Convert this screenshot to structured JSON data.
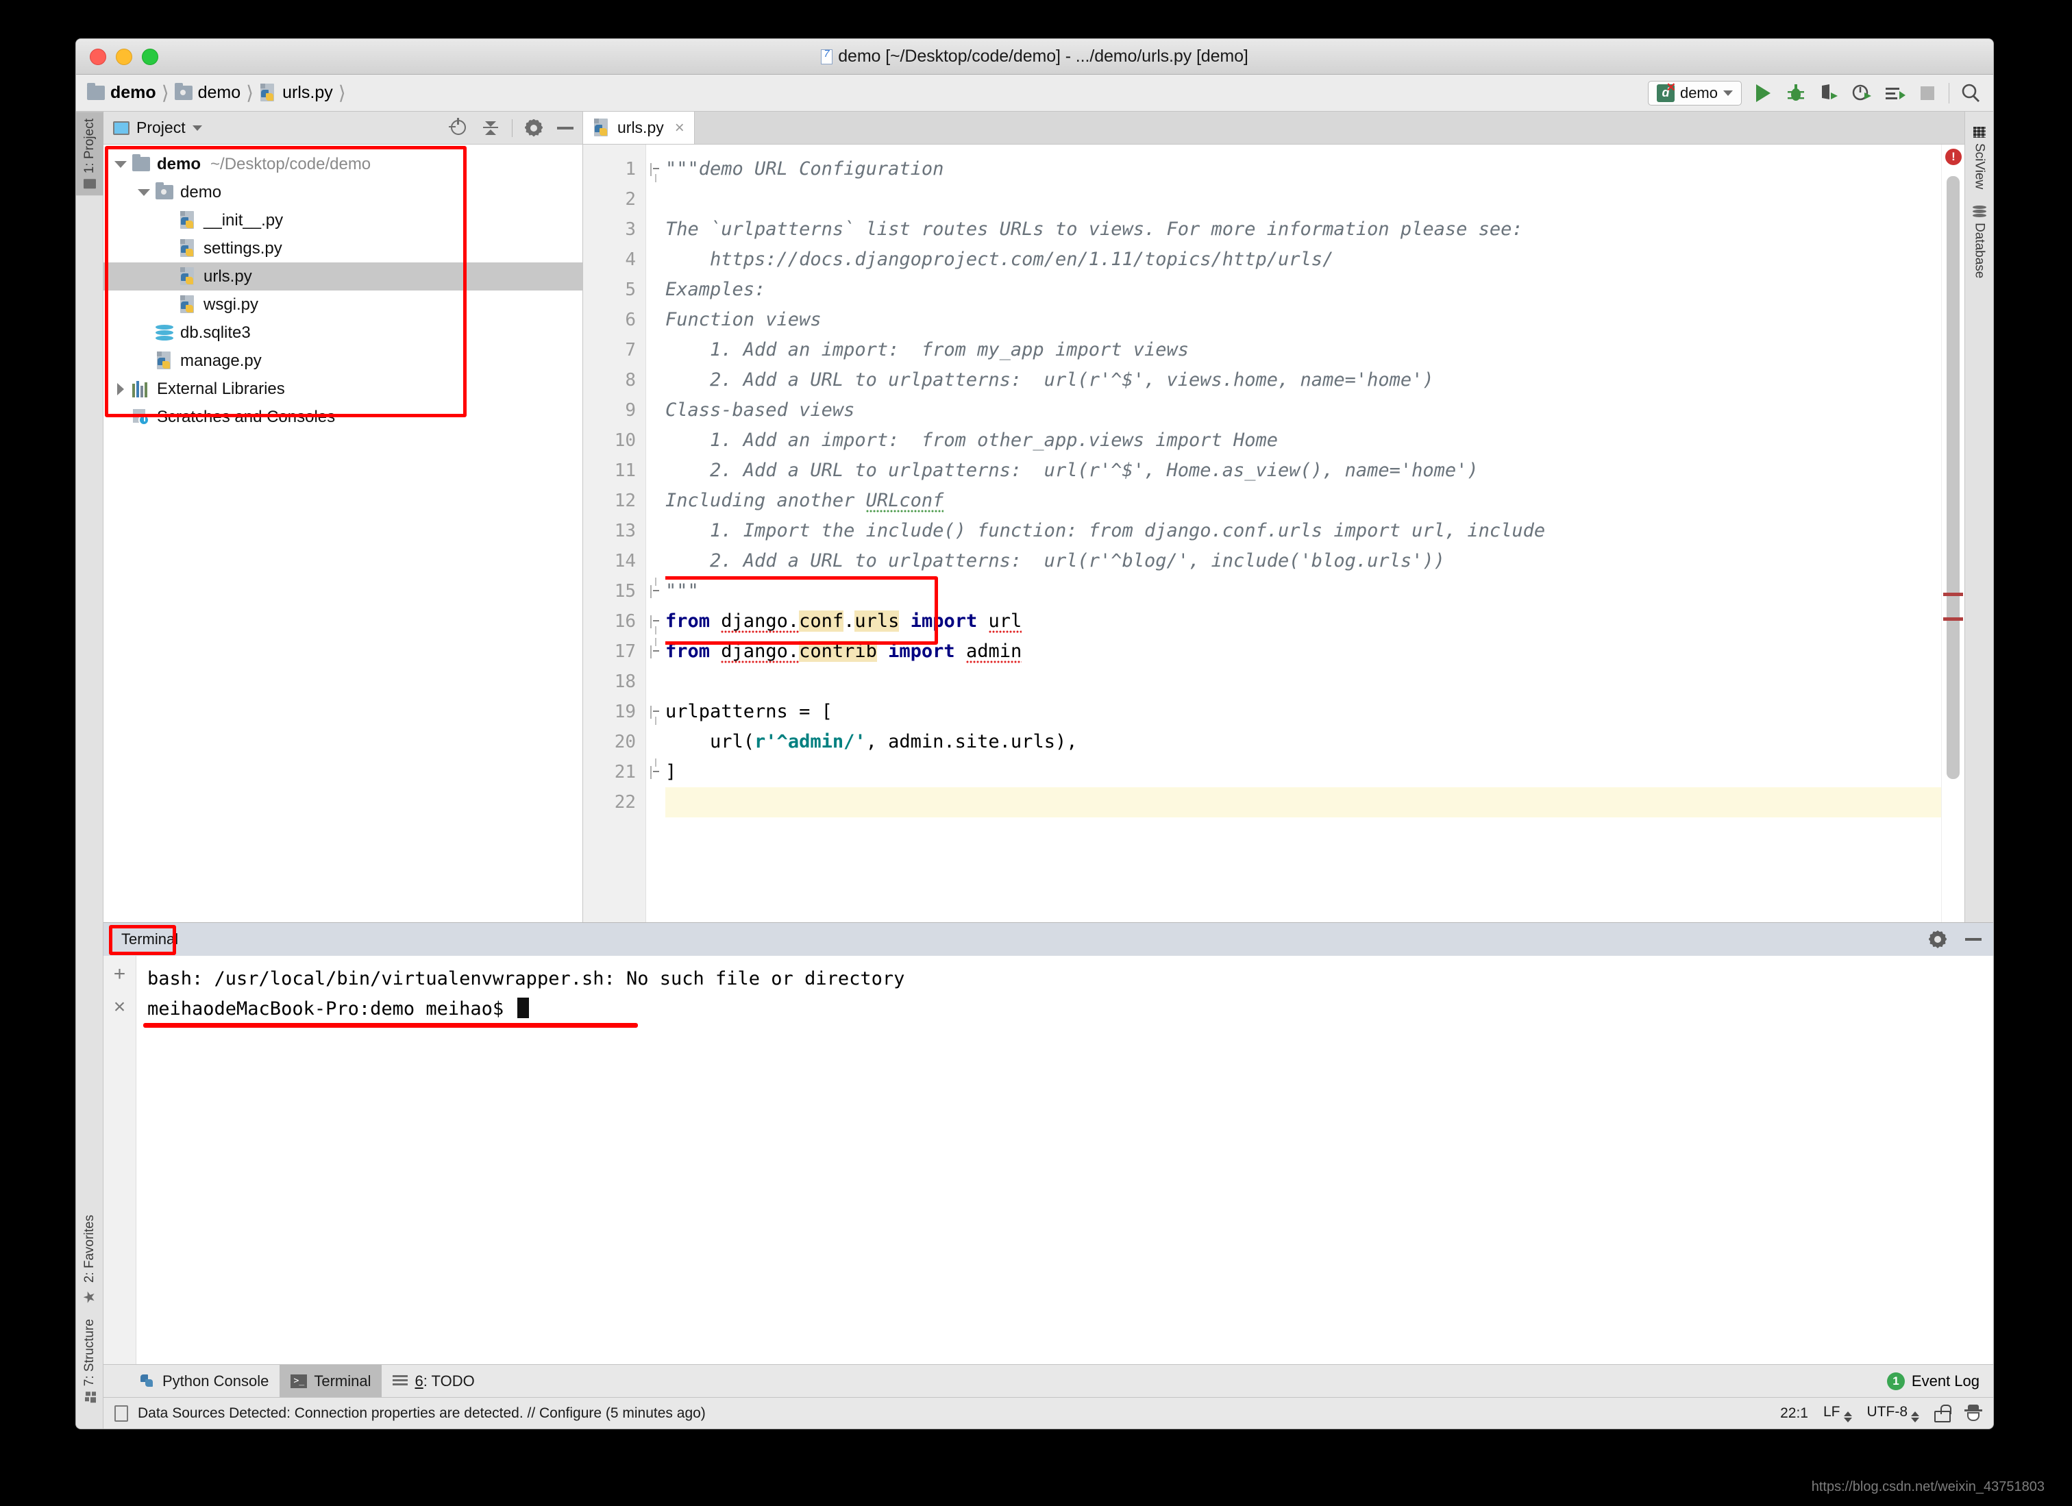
{
  "window": {
    "title": "demo [~/Desktop/code/demo] - .../demo/urls.py [demo]"
  },
  "breadcrumb": [
    {
      "label": "demo",
      "icon": "folder-icon",
      "bold": true
    },
    {
      "label": "demo",
      "icon": "source-folder-icon",
      "bold": false
    },
    {
      "label": "urls.py",
      "icon": "python-file-icon",
      "bold": false
    }
  ],
  "toolbar": {
    "run_config": "demo",
    "icons": [
      "run-icon",
      "debug-icon",
      "coverage-icon",
      "profile-icon",
      "run-with-args-icon",
      "stop-icon",
      "search-everywhere-icon"
    ]
  },
  "left_strip": {
    "tabs": [
      {
        "label": "1: Project",
        "num": "1",
        "rest": ": Project",
        "icon": "project-icon",
        "active": true
      },
      {
        "label": "2: Favorites",
        "num": "2",
        "rest": ": Favorites",
        "icon": "star-icon",
        "active": false
      },
      {
        "label": "7: Structure",
        "num": "7",
        "rest": ": Structure",
        "icon": "structure-icon",
        "active": false
      }
    ]
  },
  "right_strip": {
    "tabs": [
      {
        "label": "SciView",
        "icon": "grid-icon"
      },
      {
        "label": "Database",
        "icon": "database-icon"
      }
    ]
  },
  "project_panel": {
    "title": "Project",
    "actions": [
      "locate-icon",
      "collapse-all-icon",
      "settings-gear-icon",
      "hide-icon"
    ],
    "tree": [
      {
        "label": "demo",
        "path": "~/Desktop/code/demo",
        "icon": "folder-icon",
        "indent": 0,
        "expander": "down",
        "bold": true,
        "selected": false
      },
      {
        "label": "demo",
        "path": "",
        "icon": "source-folder-icon",
        "indent": 1,
        "expander": "down",
        "bold": false,
        "selected": false
      },
      {
        "label": "__init__.py",
        "path": "",
        "icon": "python-file-icon",
        "indent": 2,
        "expander": "none",
        "bold": false,
        "selected": false
      },
      {
        "label": "settings.py",
        "path": "",
        "icon": "python-file-icon",
        "indent": 2,
        "expander": "none",
        "bold": false,
        "selected": false
      },
      {
        "label": "urls.py",
        "path": "",
        "icon": "python-file-icon",
        "indent": 2,
        "expander": "none",
        "bold": false,
        "selected": true
      },
      {
        "label": "wsgi.py",
        "path": "",
        "icon": "python-file-icon",
        "indent": 2,
        "expander": "none",
        "bold": false,
        "selected": false
      },
      {
        "label": "db.sqlite3",
        "path": "",
        "icon": "database-file-icon",
        "indent": 1,
        "expander": "none",
        "bold": false,
        "selected": false
      },
      {
        "label": "manage.py",
        "path": "",
        "icon": "python-file-icon",
        "indent": 1,
        "expander": "none",
        "bold": false,
        "selected": false
      },
      {
        "label": "External Libraries",
        "path": "",
        "icon": "libraries-icon",
        "indent": 0,
        "expander": "right",
        "bold": false,
        "selected": false
      },
      {
        "label": "Scratches and Consoles",
        "path": "",
        "icon": "scratches-icon",
        "indent": 0,
        "expander": "none",
        "bold": false,
        "selected": false
      }
    ]
  },
  "editor": {
    "tab": {
      "label": "urls.py",
      "icon": "python-file-icon",
      "close": "×"
    },
    "line_numbers": [
      "1",
      "2",
      "3",
      "4",
      "5",
      "6",
      "7",
      "8",
      "9",
      "10",
      "11",
      "12",
      "13",
      "14",
      "15",
      "16",
      "17",
      "18",
      "19",
      "20",
      "21",
      "22"
    ],
    "lines": [
      "\"\"\"demo URL Configuration",
      "",
      "The `urlpatterns` list routes URLs to views. For more information please see:",
      "    https://docs.djangoproject.com/en/1.11/topics/http/urls/",
      "Examples:",
      "Function views",
      "    1. Add an import:  from my_app import views",
      "    2. Add a URL to urlpatterns:  url(r'^$', views.home, name='home')",
      "Class-based views",
      "    1. Add an import:  from other_app.views import Home",
      "    2. Add a URL to urlpatterns:  url(r'^$', Home.as_view(), name='home')",
      "Including another URLconf",
      "    1. Import the include() function: from django.conf.urls import url, include",
      "    2. Add a URL to urlpatterns:  url(r'^blog/', include('blog.urls'))",
      "\"\"\"",
      "from django.conf.urls import url",
      "from django.contrib import admin",
      "",
      "urlpatterns = [",
      "    url(r'^admin/', admin.site.urls),",
      "]",
      ""
    ],
    "import_line_16": {
      "kw_from": "from",
      "module": "django.",
      "hl1": "conf",
      "dot": ".",
      "hl2": "urls",
      "kw_import": "import",
      "name": "url"
    },
    "import_line_17": {
      "kw_from": "from",
      "module": "django.",
      "hl1": "contrib",
      "kw_import": "import",
      "name": "admin"
    },
    "code_line_19": "urlpatterns = [",
    "code_line_20": {
      "pre": "    url(",
      "str": "r'^admin/'",
      "post": ", admin.site.urls),"
    },
    "code_line_21": "]",
    "error_badge": "!"
  },
  "terminal": {
    "title": "Terminal",
    "side_buttons": [
      "+",
      "×"
    ],
    "actions": [
      "settings-gear-icon",
      "hide-icon"
    ],
    "lines": [
      "bash: /usr/local/bin/virtualenvwrapper.sh: No such file or directory",
      "meihaodeMacBook-Pro:demo meihao$ "
    ]
  },
  "bottom_tabs": [
    {
      "label": "Python Console",
      "icon": "python-icon",
      "active": false
    },
    {
      "label": "Terminal",
      "icon": "terminal-icon",
      "active": true
    },
    {
      "label": "6: TODO",
      "num": "6",
      "rest": ": TODO",
      "icon": "todo-icon",
      "active": false
    }
  ],
  "event_log": {
    "count": "1",
    "label": "Event Log"
  },
  "statusbar": {
    "message": "Data Sources Detected: Connection properties are detected. // Configure (5 minutes ago)",
    "caret": "22:1",
    "line_sep": "LF",
    "encoding": "UTF-8",
    "lock": "unlocked-icon",
    "inspector": "inspection-icon"
  },
  "watermark": "https://blog.csdn.net/weixin_43751803",
  "colors": {
    "accent_red": "#ff0000",
    "keyword": "#000080",
    "string": "#008080",
    "docstring": "#6a737b",
    "highlight": "#f5e6b8",
    "selection": "#c8c8c8",
    "caret_line": "#fdf9df"
  }
}
